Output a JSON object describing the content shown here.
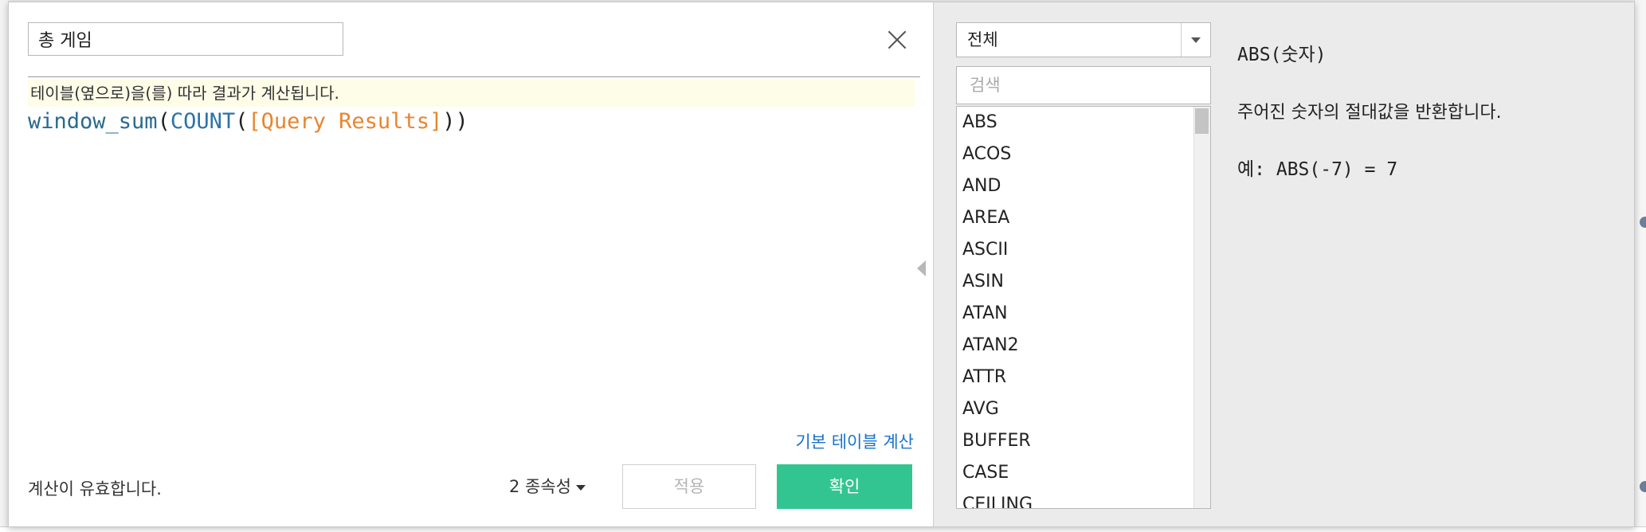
{
  "calc_name": "총 게임",
  "editor": {
    "hint": "테이블(옆으로)을(를) 따라 결과가 계산됩니다.",
    "formula": {
      "outer_fn": "window_sum",
      "open1": "(",
      "inner_fn": "COUNT",
      "open2": "(",
      "field": "[Query Results]",
      "close": "))"
    }
  },
  "footer": {
    "default_table_calc_link": "기본 테이블 계산",
    "status": "계산이 유효합니다.",
    "dependencies": "2 종속성",
    "apply": "적용",
    "ok": "확인"
  },
  "functions_panel": {
    "filter": "전체",
    "search_placeholder": "검색",
    "items": [
      "ABS",
      "ACOS",
      "AND",
      "AREA",
      "ASCII",
      "ASIN",
      "ATAN",
      "ATAN2",
      "ATTR",
      "AVG",
      "BUFFER",
      "CASE",
      "CEILING"
    ]
  },
  "description": {
    "signature": "ABS(숫자)",
    "text": "주어진 숫자의 절대값을 반환합니다.",
    "example": "예: ABS(-7) = 7"
  }
}
